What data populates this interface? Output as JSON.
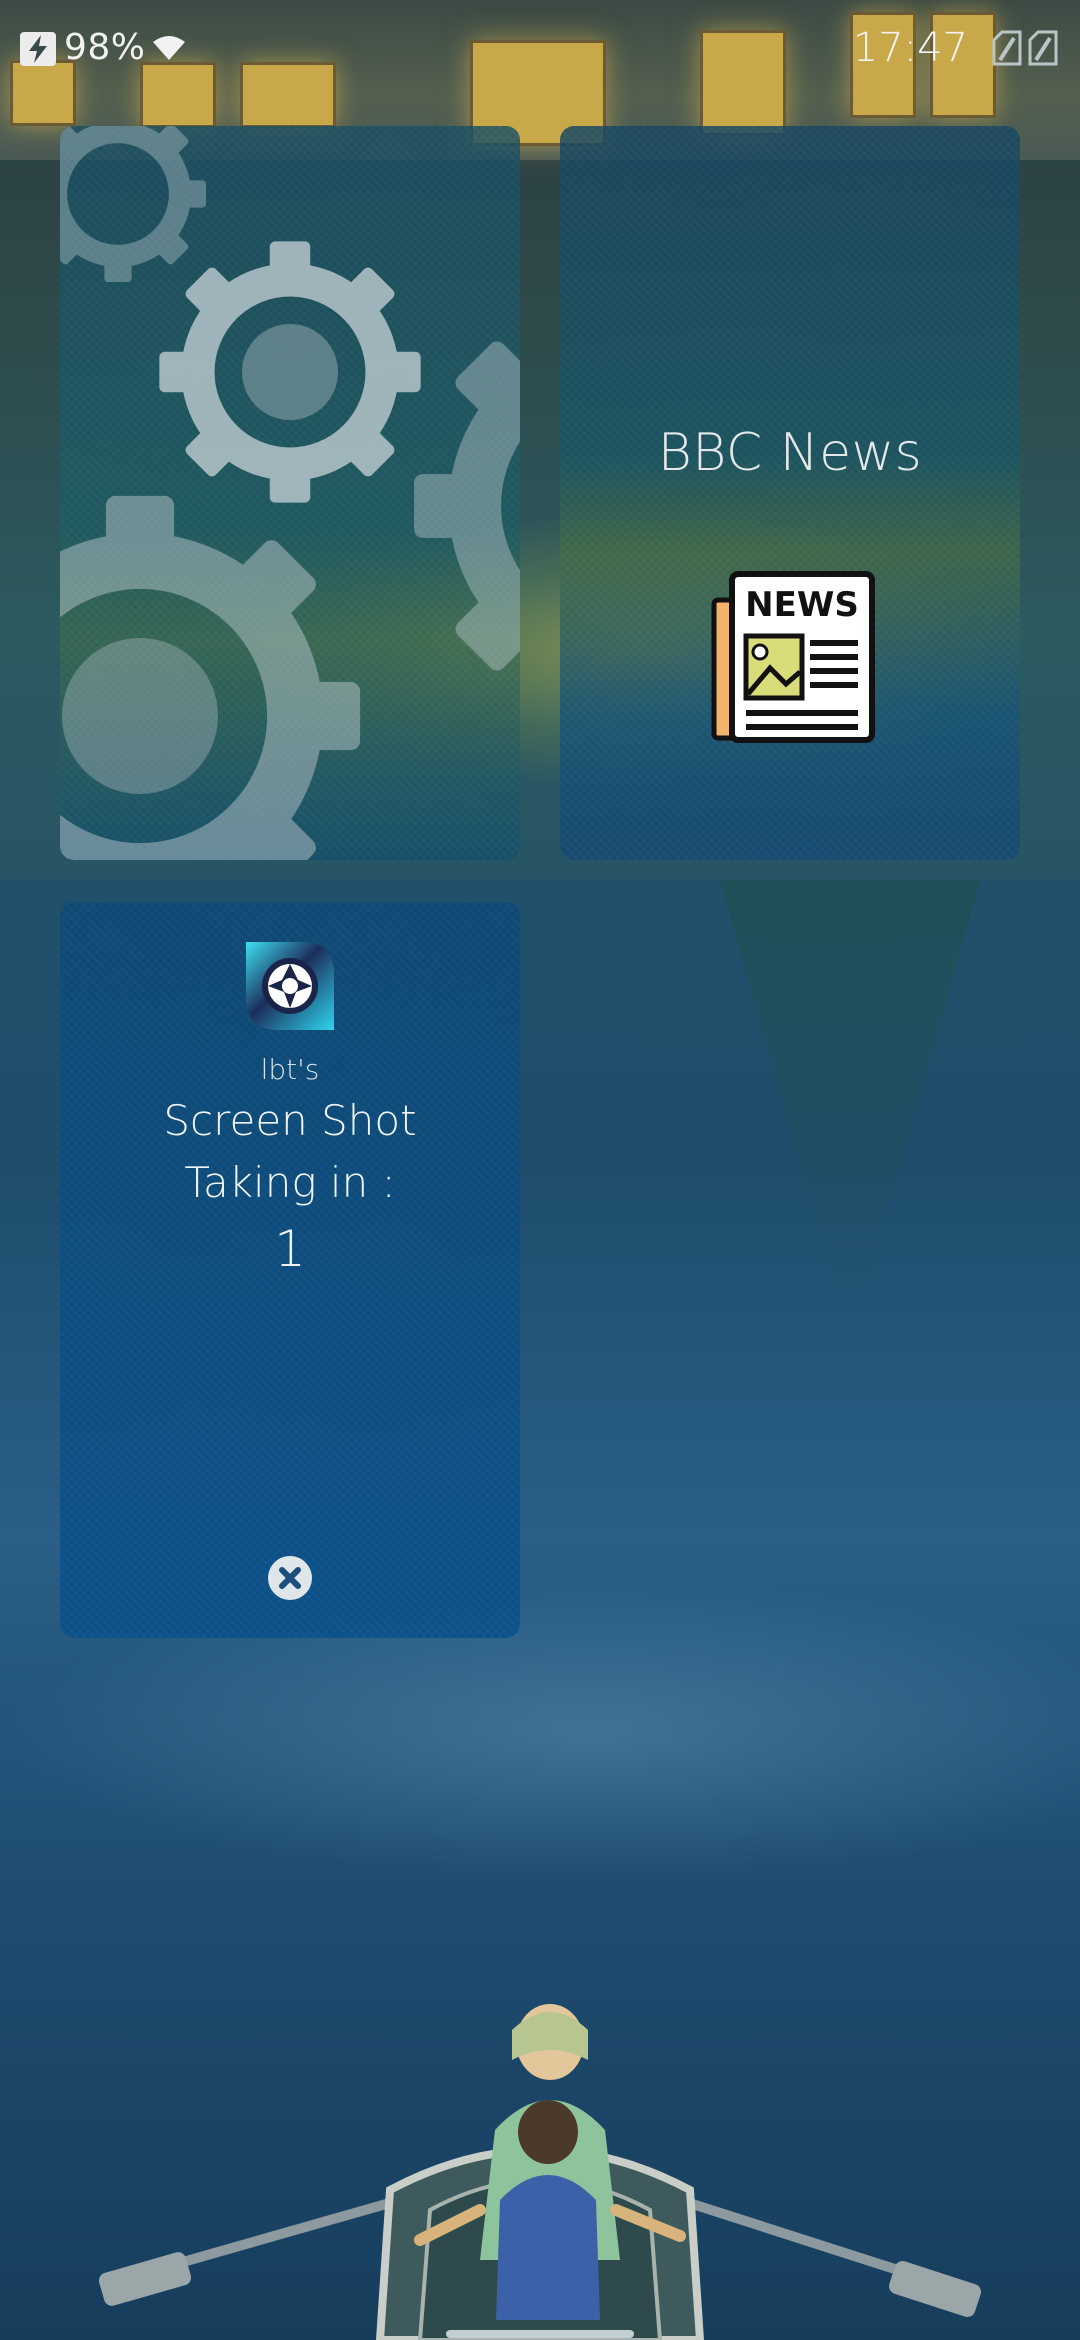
{
  "status_bar": {
    "battery": "98%",
    "clock": "17:47",
    "charging_icon": "lightning-bolt-icon",
    "wifi_icon": "wifi-icon",
    "sim_icons": [
      "sim-1-icon",
      "sim-2-icon"
    ]
  },
  "tiles": {
    "settings": {
      "icon": "gears-icon"
    },
    "bbc_news": {
      "title": "BBC News",
      "icon": "newspaper-icon",
      "icon_text": "NEWS"
    },
    "screenshot": {
      "icon": "camera-shutter-icon",
      "owner": "lbt's",
      "title": "Screen Shot",
      "status_label": "Taking in :",
      "countdown": "1",
      "close_icon": "close-icon"
    }
  },
  "colors": {
    "tile_blue": "#0e4e84",
    "news_yellow": "#d8dd7a",
    "news_orange": "#f2b36a"
  }
}
